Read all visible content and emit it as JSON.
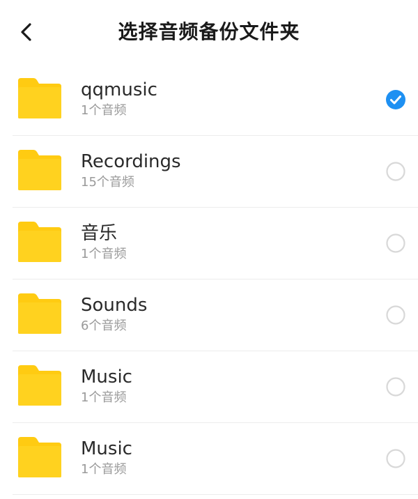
{
  "header": {
    "title": "选择音频备份文件夹",
    "back_icon": "chevron-left-icon"
  },
  "colors": {
    "folder": "#FFD21F",
    "folder_tab": "#FFCB12",
    "selected": "#1E90F2",
    "unselected_ring": "#D8D8D8"
  },
  "folders": [
    {
      "name": "qqmusic",
      "count": "1个音频",
      "selected": true,
      "icon": "folder-icon"
    },
    {
      "name": "Recordings",
      "count": "15个音频",
      "selected": false,
      "icon": "folder-icon"
    },
    {
      "name": "音乐",
      "count": "1个音频",
      "selected": false,
      "icon": "folder-icon"
    },
    {
      "name": "Sounds",
      "count": "6个音频",
      "selected": false,
      "icon": "folder-icon"
    },
    {
      "name": "Music",
      "count": "1个音频",
      "selected": false,
      "icon": "folder-icon"
    },
    {
      "name": "Music",
      "count": "1个音频",
      "selected": false,
      "icon": "folder-icon"
    }
  ]
}
